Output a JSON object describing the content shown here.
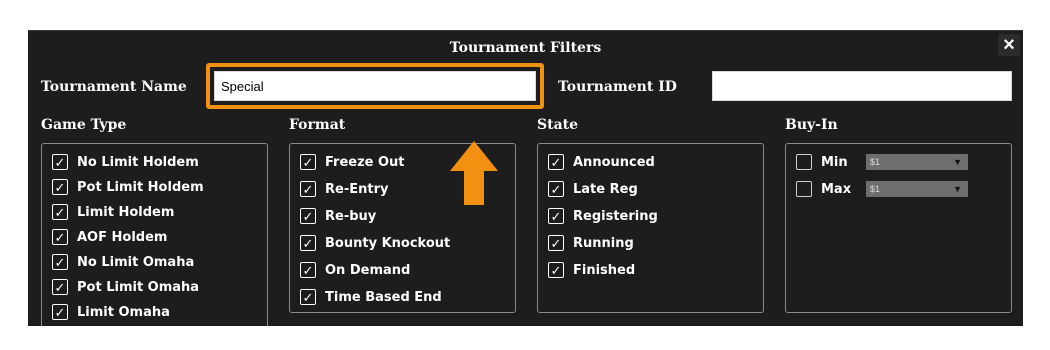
{
  "dialog": {
    "title": "Tournament Filters",
    "close_icon": "×"
  },
  "fields": {
    "tournament_name_label": "Tournament Name",
    "tournament_name_value": "Special",
    "tournament_id_label": "Tournament ID",
    "tournament_id_value": ""
  },
  "game_type": {
    "header": "Game Type",
    "items": [
      {
        "label": "No Limit Holdem",
        "checked": true
      },
      {
        "label": "Pot Limit Holdem",
        "checked": true
      },
      {
        "label": "Limit Holdem",
        "checked": true
      },
      {
        "label": "AOF Holdem",
        "checked": true
      },
      {
        "label": "No Limit Omaha",
        "checked": true
      },
      {
        "label": "Pot Limit Omaha",
        "checked": true
      },
      {
        "label": "Limit Omaha",
        "checked": true
      }
    ]
  },
  "format": {
    "header": "Format",
    "items": [
      {
        "label": "Freeze Out",
        "checked": true
      },
      {
        "label": "Re-Entry",
        "checked": true
      },
      {
        "label": "Re-buy",
        "checked": true
      },
      {
        "label": "Bounty Knockout",
        "checked": true
      },
      {
        "label": "On Demand",
        "checked": true
      },
      {
        "label": "Time Based End",
        "checked": true
      }
    ]
  },
  "state": {
    "header": "State",
    "items": [
      {
        "label": "Announced",
        "checked": true
      },
      {
        "label": "Late Reg",
        "checked": true
      },
      {
        "label": "Registering",
        "checked": true
      },
      {
        "label": "Running",
        "checked": true
      },
      {
        "label": "Finished",
        "checked": true
      }
    ]
  },
  "buy_in": {
    "header": "Buy-In",
    "min_label": "Min",
    "min_value": "$1",
    "min_checked": false,
    "max_label": "Max",
    "max_value": "$1",
    "max_checked": false,
    "dropdown_icon": "▼"
  },
  "colors": {
    "dialog_bg": "#1d1d1d",
    "highlight": "#f29111"
  },
  "icons": {
    "check": "✓",
    "arrow": "arrow-up-icon"
  }
}
